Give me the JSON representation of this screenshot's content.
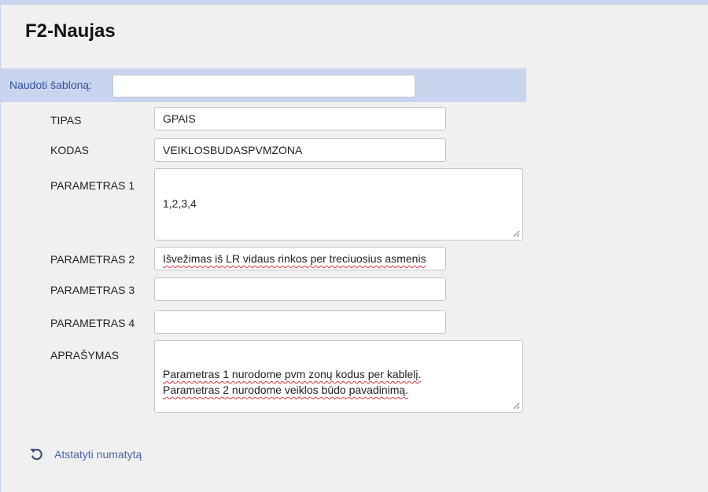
{
  "page": {
    "title": "F2-Naujas"
  },
  "template": {
    "label": "Naudoti šabloną:",
    "value": ""
  },
  "fields": [
    {
      "label": "TIPAS",
      "value": "GPAIS"
    },
    {
      "label": "KODAS",
      "value": "VEIKLOSBUDASPVMZONA"
    },
    {
      "label": "PARAMETRAS 1",
      "value": "1,2,3,4"
    },
    {
      "label": "PARAMETRAS 2",
      "value": "Išvežimas iš LR vidaus rinkos per treciuosius asmenis"
    },
    {
      "label": "PARAMETRAS 3",
      "value": ""
    },
    {
      "label": "PARAMETRAS 4",
      "value": ""
    },
    {
      "label": "APRAŠYMAS",
      "value": "Parametras 1 nurodome pvm zonų kodus per kablelį.\nParametras 2 nurodome veiklos būdo pavadinimą."
    }
  ],
  "actions": {
    "reset_label": "Atstatyti numatytą",
    "reset_icon": "undo-icon"
  },
  "colors": {
    "accent_bar": "#c9d5ef",
    "link": "#4a64a8",
    "template_label": "#2e4f9c",
    "spellcheck": "#e0333a"
  }
}
